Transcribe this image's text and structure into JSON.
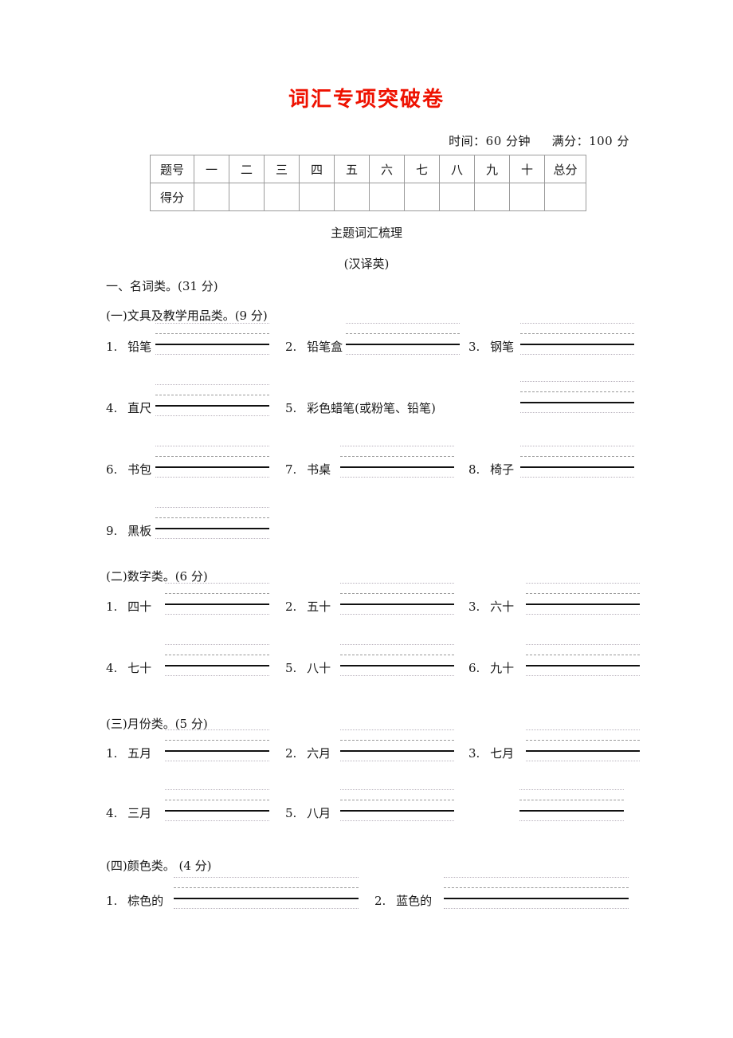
{
  "document": {
    "title": "词汇专项突破卷",
    "title_color": "#ee1100",
    "meta": {
      "time": "时间：60 分钟",
      "full_score": "满分：100 分"
    },
    "center_headings": {
      "line1": "主题词汇梳理",
      "line2": "(汉译英)"
    }
  },
  "score_table": {
    "header": [
      "题号",
      "一",
      "二",
      "三",
      "四",
      "五",
      "六",
      "七",
      "八",
      "九",
      "十",
      "总分"
    ],
    "row_label": "得分",
    "row_values": [
      "",
      "",
      "",
      "",
      "",
      "",
      "",
      "",
      "",
      "",
      ""
    ]
  },
  "sections": [
    {
      "id": "nouns",
      "heading": "一、名词类。(31 分)",
      "subsections": [
        {
          "id": "stationery",
          "heading": "(一)文具及教学用品类。(9 分)",
          "items": [
            {
              "num": "1.",
              "label": "铅笔"
            },
            {
              "num": "2.",
              "label": "铅笔盒"
            },
            {
              "num": "3.",
              "label": "钢笔"
            },
            {
              "num": "4.",
              "label": "直尺"
            },
            {
              "num": "5.",
              "label": "彩色蜡笔(或粉笔、铅笔)"
            },
            {
              "num": "6.",
              "label": "书包"
            },
            {
              "num": "7.",
              "label": "书桌"
            },
            {
              "num": "8.",
              "label": "椅子"
            },
            {
              "num": "9.",
              "label": "黑板"
            }
          ]
        },
        {
          "id": "numbers",
          "heading": "(二)数字类。(6 分)",
          "items": [
            {
              "num": "1.",
              "label": "四十"
            },
            {
              "num": "2.",
              "label": "五十"
            },
            {
              "num": "3.",
              "label": "六十"
            },
            {
              "num": "4.",
              "label": "七十"
            },
            {
              "num": "5.",
              "label": "八十"
            },
            {
              "num": "6.",
              "label": "九十"
            }
          ]
        },
        {
          "id": "months",
          "heading": "(三)月份类。(5 分)",
          "items": [
            {
              "num": "1.",
              "label": "五月"
            },
            {
              "num": "2.",
              "label": "六月"
            },
            {
              "num": "3.",
              "label": "七月"
            },
            {
              "num": "4.",
              "label": "三月"
            },
            {
              "num": "5.",
              "label": "八月"
            }
          ]
        },
        {
          "id": "colors",
          "heading": "(四)颜色类。 (4 分)",
          "items": [
            {
              "num": "1.",
              "label": "棕色的"
            },
            {
              "num": "2.",
              "label": "蓝色的"
            }
          ]
        }
      ]
    }
  ]
}
